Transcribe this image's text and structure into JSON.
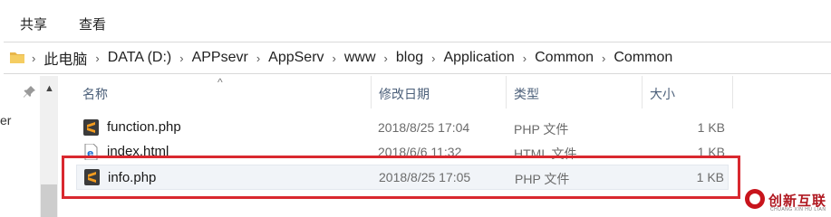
{
  "ribbon": {
    "tabs": [
      "共享",
      "查看"
    ]
  },
  "address_bar": {
    "breadcrumbs": [
      "此电脑",
      "DATA (D:)",
      "APPsevr",
      "AppServ",
      "www",
      "blog",
      "Application",
      "Common",
      "Common"
    ]
  },
  "nav_pane": {
    "partial_text": "er"
  },
  "columns": {
    "name": "名称",
    "date": "修改日期",
    "type": "类型",
    "size": "大小"
  },
  "files": [
    {
      "name": "function.php",
      "date": "2018/8/25 17:04",
      "type": "PHP 文件",
      "size": "1 KB",
      "icon": "sublime-file-icon"
    },
    {
      "name": "index.html",
      "date": "2018/6/6 11:32",
      "type": "HTML 文件",
      "size": "1 KB",
      "icon": "html-file-icon"
    },
    {
      "name": "info.php",
      "date": "2018/8/25 17:05",
      "type": "PHP 文件",
      "size": "1 KB",
      "icon": "sublime-file-icon"
    }
  ],
  "highlight_color": "#d9282f",
  "watermark": {
    "text": "创新互联",
    "sub": "CHUANG XIN HU LIAN"
  }
}
